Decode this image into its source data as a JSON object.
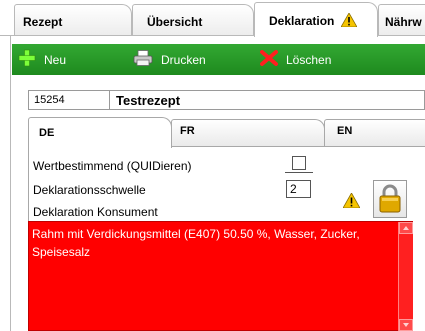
{
  "top_tabs": [
    {
      "label": "Rezept"
    },
    {
      "label": "Übersicht"
    },
    {
      "label": "Deklaration"
    },
    {
      "label": "Nährw"
    }
  ],
  "active_top_tab": "Deklaration",
  "toolbar": {
    "new_label": "Neu",
    "print_label": "Drucken",
    "delete_label": "Löschen",
    "background_color": "#2a9a2a"
  },
  "recipe": {
    "number": "15254",
    "name": "Testrezept"
  },
  "language_tabs": [
    {
      "label": "DE"
    },
    {
      "label": "FR"
    },
    {
      "label": "EN"
    }
  ],
  "active_language_tab": "DE",
  "fields": {
    "wertbestimmend_label": "Wertbestimmend (QUIDieren)",
    "wertbestimmend_checked": false,
    "schwelle_label": "Deklarationsschwelle",
    "schwelle_value": "2",
    "konsument_label": "Deklaration Konsument"
  },
  "declaration": {
    "text": "Rahm mit Verdickungsmittel (E407) 50.50 %, Wasser, Zucker, Speisesalz",
    "background_color": "#ff0000"
  },
  "icons": {
    "new": "plus-icon",
    "print": "printer-icon",
    "delete": "x-icon",
    "warning": "warning-icon",
    "lock": "padlock-icon"
  }
}
